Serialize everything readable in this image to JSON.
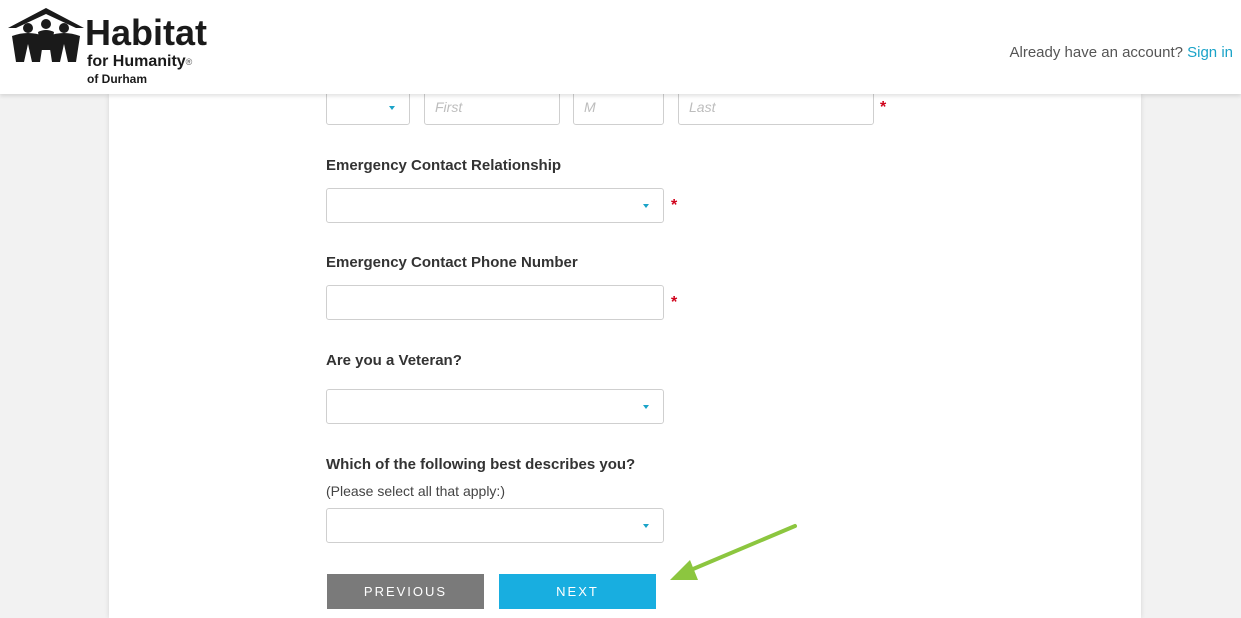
{
  "header": {
    "logo": {
      "title": "Habitat",
      "subtitle": "for Humanity",
      "registered": "®",
      "chapter": "of Durham"
    },
    "account_prompt": "Already have an account?",
    "sign_in_label": "Sign in"
  },
  "form": {
    "name_row": {
      "prefix_value": "",
      "first_placeholder": "First",
      "middle_placeholder": "M",
      "last_placeholder": "Last",
      "required_mark": "*"
    },
    "relationship": {
      "label": "Emergency Contact Relationship",
      "value": "",
      "required_mark": "*"
    },
    "phone": {
      "label": "Emergency Contact Phone Number",
      "value": "",
      "required_mark": "*"
    },
    "veteran": {
      "label": "Are you a Veteran?",
      "value": ""
    },
    "describes": {
      "label": "Which of the following best describes you?",
      "sublabel": "(Please select all that apply:)",
      "value": ""
    },
    "buttons": {
      "previous": "PREVIOUS",
      "next": "NEXT"
    }
  },
  "colors": {
    "accent": "#18aee0",
    "link": "#1aa3c8",
    "required": "#d0021b",
    "previous_button": "#7a7a7a",
    "annotation_arrow": "#8cc63f"
  },
  "icons": [
    "habitat-logo-icon",
    "dropdown-caret-icon",
    "annotation-arrow-icon"
  ]
}
